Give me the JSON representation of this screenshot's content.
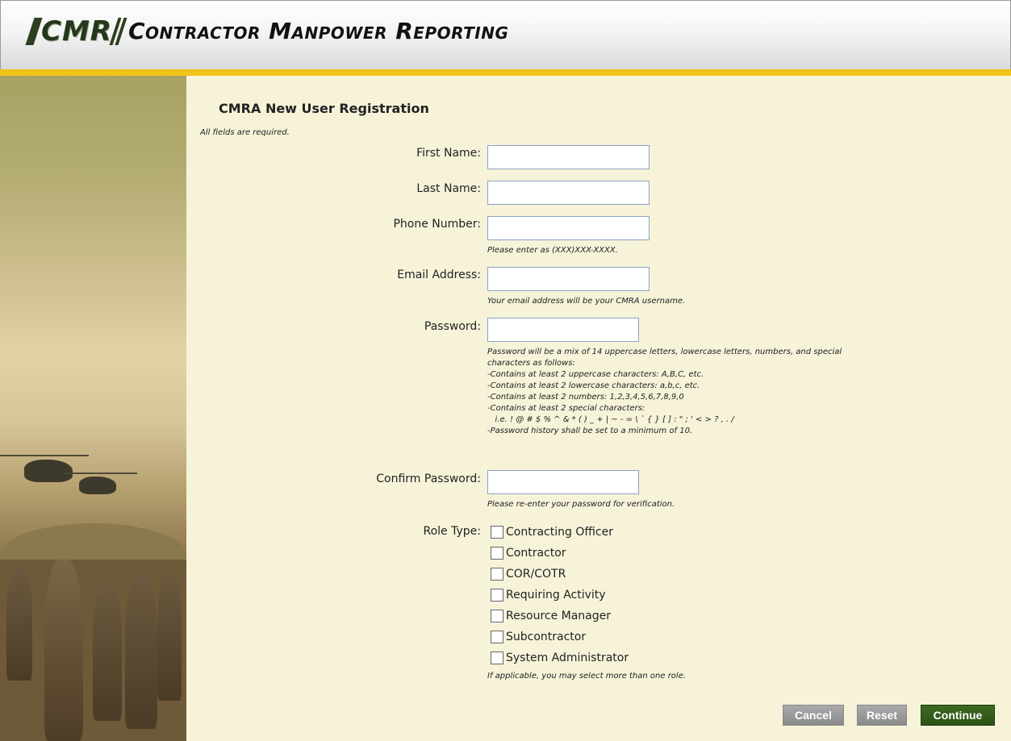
{
  "header": {
    "logo_acronym": "CMR",
    "logo_title": "Contractor Manpower Reporting"
  },
  "form": {
    "title": "CMRA New User Registration",
    "required_note": "All fields are required.",
    "first_name": {
      "label": "First Name:",
      "value": ""
    },
    "last_name": {
      "label": "Last Name:",
      "value": ""
    },
    "phone": {
      "label": "Phone Number:",
      "value": "",
      "help": "Please enter as (XXX)XXX-XXXX."
    },
    "email": {
      "label": "Email Address:",
      "value": "",
      "help": "Your email address will be your CMRA username."
    },
    "password": {
      "label": "Password:",
      "value": "",
      "help_lines": [
        "Password will be a mix of 14 uppercase letters, lowercase letters, numbers, and special",
        "characters as follows:",
        "-Contains at least 2 uppercase characters: A,B,C, etc.",
        "-Contains at least 2 lowercase characters: a,b,c, etc.",
        "-Contains at least 2 numbers: 1,2,3,4,5,6,7,8,9,0",
        "-Contains at least 2 special characters:",
        "   i.e. ! @ # $ % ^ & * ( ) _ + | ~ - = \\ ` { } [ ] : \" ; ' < > ? , . /",
        "-Password history shall be set to a minimum of 10."
      ]
    },
    "confirm_password": {
      "label": "Confirm Password:",
      "value": "",
      "help": "Please re-enter your password for verification."
    },
    "role_type": {
      "label": "Role Type:",
      "options": [
        {
          "label": "Contracting Officer",
          "checked": false
        },
        {
          "label": "Contractor",
          "checked": false
        },
        {
          "label": "COR/COTR",
          "checked": false
        },
        {
          "label": "Requiring Activity",
          "checked": false
        },
        {
          "label": "Resource Manager",
          "checked": false
        },
        {
          "label": "Subcontractor",
          "checked": false
        },
        {
          "label": "System Administrator",
          "checked": false
        }
      ],
      "help": "If applicable, you may select more than one role."
    }
  },
  "buttons": {
    "cancel": "Cancel",
    "reset": "Reset",
    "continue": "Continue"
  },
  "colors": {
    "accent_yellow": "#f0c419",
    "continue_green": "#2c5216",
    "page_background": "#f6f3d9"
  }
}
